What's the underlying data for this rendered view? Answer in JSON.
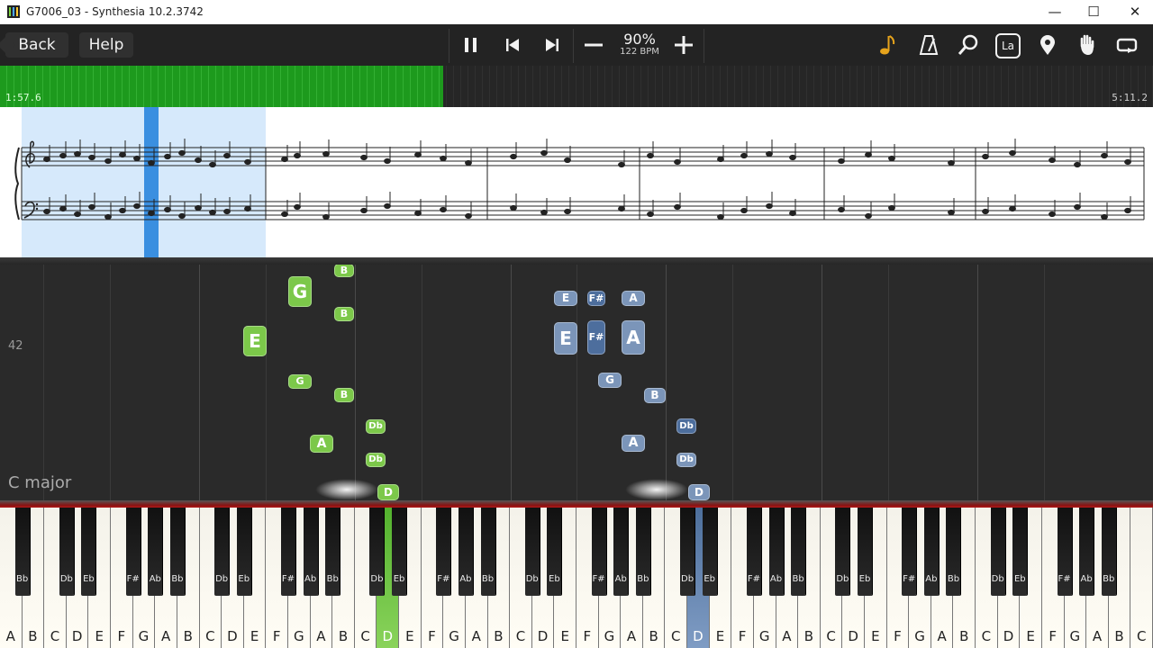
{
  "window": {
    "title": "G7006_03 - Synthesia 10.2.3742",
    "minimize": "—",
    "maximize": "☐",
    "close": "✕"
  },
  "toolbar": {
    "back_label": "Back",
    "help_label": "Help",
    "speed_percent": "90%",
    "tempo": "122 BPM",
    "icons": {
      "play": "pause-icon",
      "prev": "skip-back-icon",
      "next": "skip-forward-icon",
      "minus": "minus-icon",
      "plus": "plus-icon",
      "note": "music-note-icon",
      "metronome": "metronome-icon",
      "search": "magnifier-icon",
      "labels": "La",
      "location": "location-pin-icon",
      "hand": "hand-icon",
      "loop": "loop-icon"
    }
  },
  "progress": {
    "current_time": "1:57.6",
    "total_time": "5:11.2",
    "fraction": 0.384,
    "fill_color": "#2aa12a"
  },
  "falling": {
    "measure_number": "42",
    "key_signature": "C major",
    "notes": [
      {
        "label": "B",
        "hand": "green",
        "size": "small"
      },
      {
        "label": "G",
        "hand": "green",
        "size": "large"
      },
      {
        "label": "B",
        "hand": "green",
        "size": "small"
      },
      {
        "label": "E",
        "hand": "green",
        "size": "large"
      },
      {
        "label": "G",
        "hand": "green",
        "size": "small"
      },
      {
        "label": "B",
        "hand": "green",
        "size": "small"
      },
      {
        "label": "Db",
        "hand": "green",
        "size": "small"
      },
      {
        "label": "A",
        "hand": "green",
        "size": "small"
      },
      {
        "label": "Db",
        "hand": "green",
        "size": "small"
      },
      {
        "label": "D",
        "hand": "green",
        "size": "small"
      },
      {
        "label": "E",
        "hand": "blue",
        "size": "small"
      },
      {
        "label": "F#",
        "hand": "blue",
        "size": "small"
      },
      {
        "label": "A",
        "hand": "blue",
        "size": "small"
      },
      {
        "label": "E",
        "hand": "blue",
        "size": "large"
      },
      {
        "label": "F#",
        "hand": "blue",
        "size": "large"
      },
      {
        "label": "A",
        "hand": "blue",
        "size": "large"
      },
      {
        "label": "G",
        "hand": "blue",
        "size": "small"
      },
      {
        "label": "B",
        "hand": "blue",
        "size": "small"
      },
      {
        "label": "Db",
        "hand": "blue",
        "size": "small"
      },
      {
        "label": "A",
        "hand": "blue",
        "size": "small"
      },
      {
        "label": "Db",
        "hand": "blue",
        "size": "small"
      },
      {
        "label": "D",
        "hand": "blue",
        "size": "small"
      }
    ]
  },
  "keyboard": {
    "white_keys": [
      "A",
      "B",
      "C",
      "D",
      "E",
      "F",
      "G",
      "A",
      "B",
      "C",
      "D",
      "E",
      "F",
      "G",
      "A",
      "B",
      "C",
      "D",
      "E",
      "F",
      "G",
      "A",
      "B",
      "C",
      "D",
      "E",
      "F",
      "G",
      "A",
      "B",
      "C",
      "D",
      "E",
      "F",
      "G",
      "A",
      "B",
      "C",
      "D",
      "E",
      "F",
      "G",
      "A",
      "B",
      "C",
      "D",
      "E",
      "F",
      "G",
      "A",
      "B",
      "C"
    ],
    "black_keys": [
      "Bb",
      "Db",
      "Eb",
      "F#",
      "Ab",
      "Bb",
      "Db",
      "Eb",
      "F#",
      "Ab",
      "Bb",
      "Db",
      "Eb",
      "F#",
      "Ab",
      "Bb",
      "Db",
      "Eb",
      "F#",
      "Ab",
      "Bb",
      "Db",
      "Eb",
      "F#",
      "Ab",
      "Bb",
      "Db",
      "Eb",
      "F#",
      "Ab",
      "Bb",
      "Db",
      "Eb",
      "F#",
      "Ab",
      "Bb"
    ],
    "pressed_left": "D",
    "pressed_right": "D"
  }
}
